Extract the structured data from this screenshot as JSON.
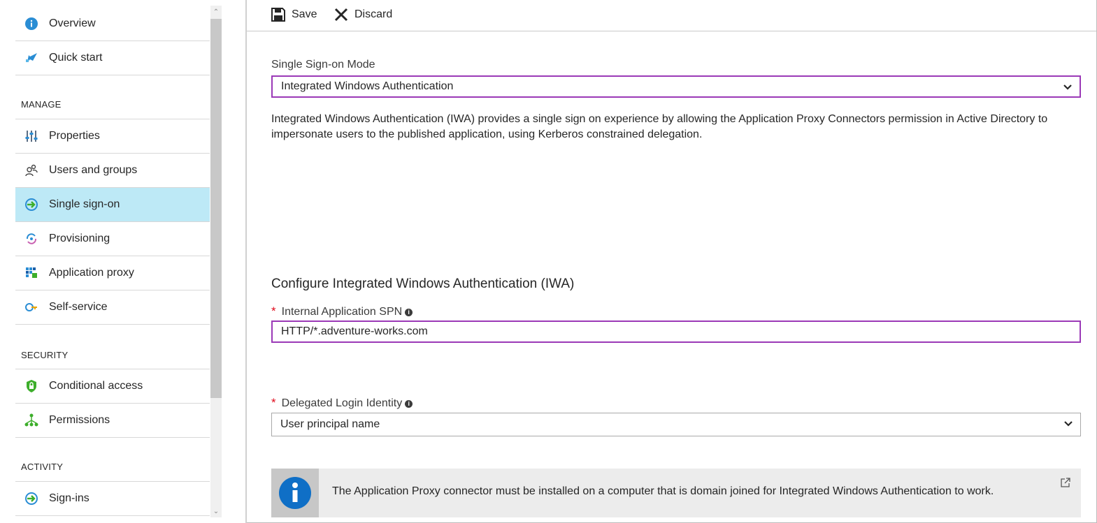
{
  "sidebar": {
    "items": [
      {
        "label": "Overview",
        "icon": "info-icon"
      },
      {
        "label": "Quick start",
        "icon": "rocket-icon"
      },
      {
        "label": "Properties",
        "icon": "sliders-icon"
      },
      {
        "label": "Users and groups",
        "icon": "users-icon"
      },
      {
        "label": "Single sign-on",
        "icon": "sso-arrow-icon",
        "active": true
      },
      {
        "label": "Provisioning",
        "icon": "sync-icon"
      },
      {
        "label": "Application proxy",
        "icon": "grid-icon"
      },
      {
        "label": "Self-service",
        "icon": "key-icon"
      },
      {
        "label": "Conditional access",
        "icon": "shield-icon"
      },
      {
        "label": "Permissions",
        "icon": "hierarchy-icon"
      },
      {
        "label": "Sign-ins",
        "icon": "signin-arrow-icon"
      }
    ],
    "sections": {
      "manage": "MANAGE",
      "security": "SECURITY",
      "activity": "ACTIVITY"
    }
  },
  "toolbar": {
    "save_label": "Save",
    "discard_label": "Discard"
  },
  "form": {
    "sso_mode_label": "Single Sign-on Mode",
    "sso_mode_value": "Integrated Windows Authentication",
    "description": "Integrated Windows Authentication (IWA) provides a single sign on experience by allowing the Application Proxy Connectors permission in Active Directory to impersonate users to the published application, using Kerberos constrained delegation.",
    "section_title": "Configure Integrated Windows Authentication (IWA)",
    "spn_label": "Internal Application SPN",
    "spn_value": "HTTP/*.adventure-works.com",
    "identity_label": "Delegated Login Identity",
    "identity_value": "User principal name",
    "required_mark": "*"
  },
  "notice": {
    "message": "The Application Proxy connector must be installed on a computer that is domain joined for Integrated Windows Authentication to work."
  },
  "colors": {
    "active_bg": "#bde9f6",
    "focus_border": "#9b39b7",
    "info_blue": "#0f6fc6",
    "required_red": "#e00b1c"
  }
}
